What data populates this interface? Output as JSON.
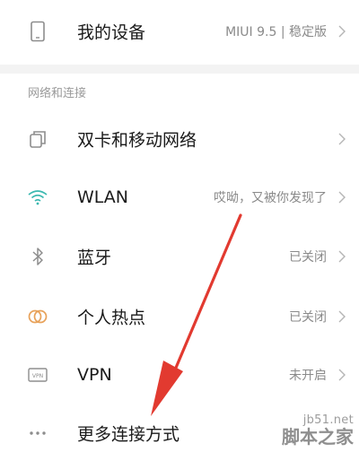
{
  "my_device": {
    "title": "我的设备",
    "value": "MIUI 9.5 | 稳定版",
    "icon": "phone-icon"
  },
  "section": {
    "label": "网络和连接"
  },
  "items": [
    {
      "title": "双卡和移动网络",
      "value": "",
      "icon": "sim-cards-icon"
    },
    {
      "title": "WLAN",
      "value": "哎呦，又被你发现了",
      "icon": "wifi-icon"
    },
    {
      "title": "蓝牙",
      "value": "已关闭",
      "icon": "bluetooth-icon"
    },
    {
      "title": "个人热点",
      "value": "已关闭",
      "icon": "hotspot-icon"
    },
    {
      "title": "VPN",
      "value": "未开启",
      "icon": "vpn-icon"
    },
    {
      "title": "更多连接方式",
      "value": "",
      "icon": "more-dots-icon"
    }
  ],
  "vpn_icon_text": "VPN",
  "watermark": {
    "url": "jb51.net",
    "name": "脚本之家"
  },
  "colors": {
    "icon_gray": "#8d8d8d",
    "wifi_teal": "#3bb8b0",
    "hotspot_orange": "#e8a25a",
    "arrow_red": "#e23a30"
  }
}
